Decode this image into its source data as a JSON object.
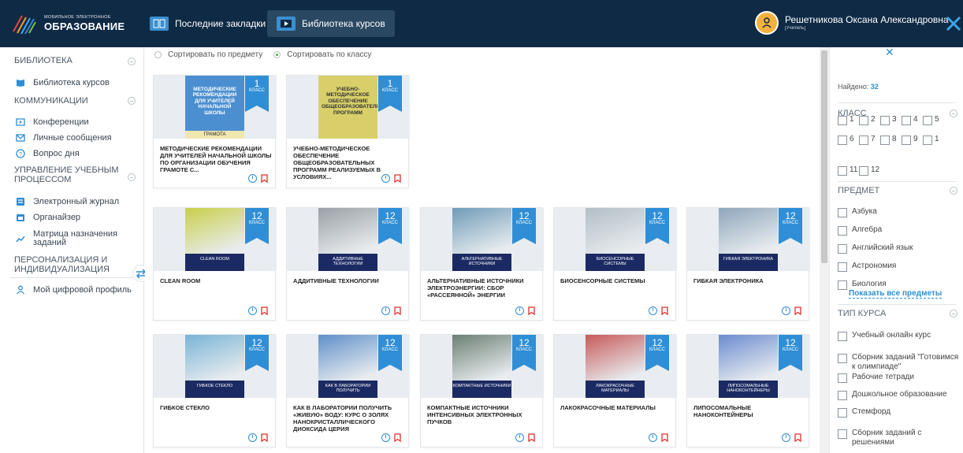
{
  "app": {
    "logo_small": "МОБИЛЬНОЕ ЭЛЕКТРОННОЕ",
    "logo_big": "ОБРАЗОВАНИЕ"
  },
  "header": {
    "tabs": [
      {
        "label": "Последние закладки"
      },
      {
        "label": "Библиотека курсов"
      }
    ],
    "user_name": "Решетникова Оксана Александровна",
    "user_role": "[Учитель]"
  },
  "sidebar": {
    "sections": {
      "library": "БИБЛИОТЕКА",
      "comm": "КОММУНИКАЦИИ",
      "manage": "УПРАВЛЕНИЕ УЧЕБНЫМ ПРОЦЕССОМ",
      "person": "ПЕРСОНАЛИЗАЦИЯ И ИНДИВИДУАЛИЗАЦИЯ"
    },
    "items": {
      "lib": "Библиотека курсов",
      "conf": "Конференции",
      "msg": "Личные сообщения",
      "question": "Вопрос дня",
      "journal": "Электронный журнал",
      "organizer": "Органайзер",
      "matrix": "Матрица назначения заданий",
      "profile": "Мой цифровой профиль"
    }
  },
  "sort": {
    "by_subject": "Сортировать по предмету",
    "by_class": "Сортировать по классу"
  },
  "ribbon_word": "КЛАСС",
  "cards": [
    {
      "grade": "1",
      "title": "МЕТОДИЧЕСКИЕ РЕКОМЕНДАЦИИ ДЛЯ УЧИТЕЛЕЙ НАЧАЛЬНОЙ ШКОЛЫ ПО ОРГАНИЗАЦИИ ОБУЧЕНИЯ ГРАМОТЕ С...",
      "cover": "МЕТОДИЧЕСКИЕ РЕКОМЕНДАЦИИ ДЛЯ УЧИТЕЛЕЙ НАЧАЛЬНОЙ ШКОЛЫ",
      "cover_sub": "ГРАМОТА",
      "tone": "#4b8fd1"
    },
    {
      "grade": "1",
      "title": "УЧЕБНО-МЕТОДИЧЕСКОЕ ОБЕСПЕЧЕНИЕ ОБЩЕОБРАЗОВАТЕЛЬНЫХ ПРОГРАММ РЕАЛИЗУЕМЫХ В УСЛОВИЯХ...",
      "cover": "Учебно-методическое обеспечение общеобразовательных программ",
      "cover_sub": "",
      "tone": "#d8cf6a"
    },
    {
      "grade": "12",
      "title": "CLEAN ROOM",
      "cover_sub": "CLEAN ROOM",
      "tone": "#c9cf4a"
    },
    {
      "grade": "12",
      "title": "АДДИТИВНЫЕ ТЕХНОЛОГИИ",
      "cover_sub": "АДДИТИВНЫЕ ТЕХНОЛОГИИ",
      "tone": "#9aa0a6"
    },
    {
      "grade": "12",
      "title": "АЛЬТЕРНАТИВНЫЕ ИСТОЧНИКИ ЭЛЕКТРОЭНЕРГИИ: СБОР «РАССЕЯННОЙ» ЭНЕРГИИ",
      "cover_sub": "АЛЬТЕРНАТИВНЫЕ ИСТОЧНИКИ",
      "tone": "#6f9bb8"
    },
    {
      "grade": "12",
      "title": "БИОСЕНСОРНЫЕ СИСТЕМЫ",
      "cover_sub": "БИОСЕНСОРНЫЕ СИСТЕМЫ",
      "tone": "#b3bec6"
    },
    {
      "grade": "12",
      "title": "ГИБКАЯ ЭЛЕКТРОНИКА",
      "cover_sub": "ГИБКАЯ ЭЛЕКТРОНИКА",
      "tone": "#8fa6bb"
    },
    {
      "grade": "12",
      "title": "ГИБКОЕ СТЕКЛО",
      "cover_sub": "ГИБКОЕ СТЕКЛО",
      "tone": "#79b4d6"
    },
    {
      "grade": "12",
      "title": "КАК В ЛАБОРАТОРИИ ПОЛУЧИТЬ «ЖИВУЮ» ВОДУ: КУРС О ЗОЛЯХ НАНОКРИСТАЛЛИЧЕСКОГО ДИОКСИДА ЦЕРИЯ",
      "cover_sub": "КАК В ЛАБОРАТОРИИ ПОЛУЧИТЬ",
      "tone": "#5f8fc9"
    },
    {
      "grade": "12",
      "title": "КОМПАКТНЫЕ ИСТОЧНИКИ ИНТЕНСИВНЫХ ЭЛЕКТРОННЫХ ПУЧКОВ",
      "cover_sub": "КОМПАКТНЫЕ ИСТОЧНИКИ",
      "tone": "#6c7f73"
    },
    {
      "grade": "12",
      "title": "ЛАКОКРАСОЧНЫЕ МАТЕРИАЛЫ",
      "cover_sub": "ЛАКОКРАСОЧНЫЕ МАТЕРИАЛЫ",
      "tone": "#c75a5a"
    },
    {
      "grade": "12",
      "title": "ЛИПОСОМАЛЬНЫЕ НАНОКОНТЕЙНЕРЫ",
      "cover_sub": "ЛИПОСОМАЛЬНЫЕ НАНОКОНТЕЙНЕРЫ",
      "tone": "#6b8bd0"
    }
  ],
  "filters": {
    "found_label": "Найдено:",
    "found_count": "32",
    "class_head": "КЛАСС",
    "grades": [
      "1",
      "2",
      "3",
      "4",
      "5",
      "6",
      "7",
      "8",
      "9",
      "1",
      "11",
      "12"
    ],
    "subject_head": "ПРЕДМЕТ",
    "subjects": [
      "Азбука",
      "Алгебра",
      "Английский язык",
      "Астрономия",
      "Биология"
    ],
    "show_all": "Показать все предметы",
    "type_head": "ТИП КУРСА",
    "types": [
      "Учебный онлайн курс",
      "Сборник заданий \"Готовимся к олимпиаде\"",
      "Рабочие тетради",
      "Дошкольное образование",
      "Стемфорд",
      "Сборник заданий с решениями"
    ]
  },
  "colors": {
    "header_bg": "#0f2a45",
    "accent": "#2f8ed5",
    "ribbon": "#2f8ed5"
  }
}
